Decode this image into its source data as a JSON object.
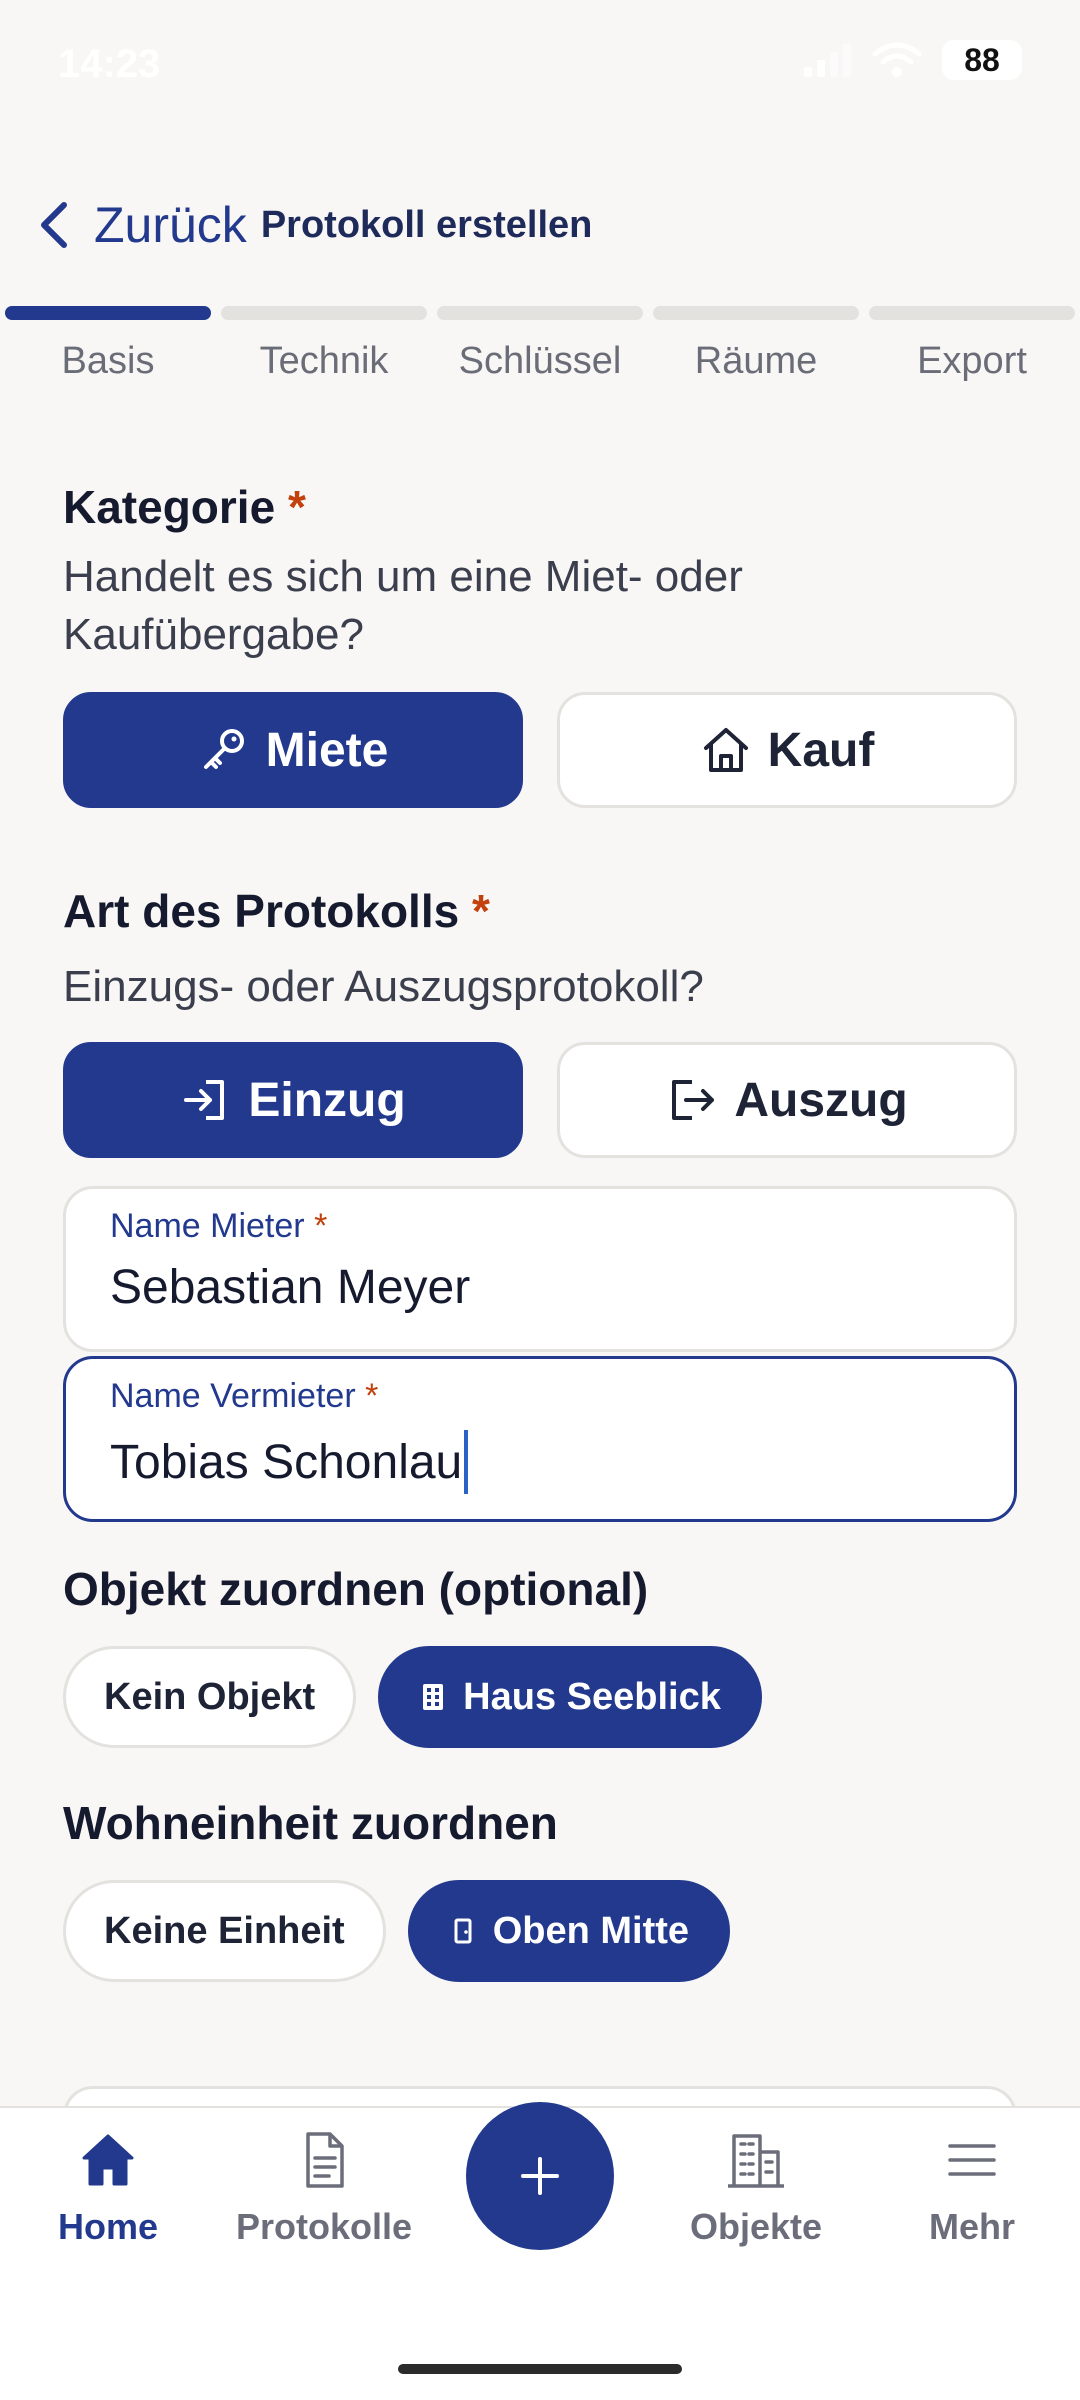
{
  "status_bar": {
    "time": "14:23",
    "battery": "88"
  },
  "header": {
    "back_label": "Zurück",
    "title": "Protokoll erstellen"
  },
  "steps": [
    {
      "label": "Basis",
      "active": true
    },
    {
      "label": "Technik",
      "active": false
    },
    {
      "label": "Schlüssel",
      "active": false
    },
    {
      "label": "Räume",
      "active": false
    },
    {
      "label": "Export",
      "active": false
    }
  ],
  "kategorie": {
    "title": "Kategorie",
    "required_mark": "*",
    "description": "Handelt es sich um eine Miet- oder Kaufübergabe?",
    "options": [
      {
        "label": "Miete",
        "icon": "key-icon",
        "selected": true
      },
      {
        "label": "Kauf",
        "icon": "house-icon",
        "selected": false
      }
    ]
  },
  "protokoll_art": {
    "title": "Art des Protokolls",
    "required_mark": "*",
    "description": "Einzugs- oder Auszugsprotokoll?",
    "options": [
      {
        "label": "Einzug",
        "icon": "sign-in-icon",
        "selected": true
      },
      {
        "label": "Auszug",
        "icon": "sign-out-icon",
        "selected": false
      }
    ]
  },
  "fields": {
    "mieter": {
      "label": "Name Mieter",
      "required_mark": "*",
      "value": "Sebastian Meyer"
    },
    "vermieter": {
      "label": "Name Vermieter",
      "required_mark": "*",
      "value": "Tobias Schonlau"
    }
  },
  "objekt": {
    "title": "Objekt zuordnen (optional)",
    "options": [
      {
        "label": "Kein Objekt",
        "selected": false
      },
      {
        "label": "Haus Seeblick",
        "icon": "building-icon",
        "selected": true
      }
    ]
  },
  "wohneinheit": {
    "title": "Wohneinheit zuordnen",
    "options": [
      {
        "label": "Keine Einheit",
        "selected": false
      },
      {
        "label": "Oben Mitte",
        "icon": "door-icon",
        "selected": true
      }
    ]
  },
  "tab_bar": {
    "items": [
      {
        "label": "Home",
        "icon": "home-icon",
        "active": true
      },
      {
        "label": "Protokolle",
        "icon": "document-icon",
        "active": false
      },
      {
        "label": "Objekte",
        "icon": "buildings-icon",
        "active": false
      },
      {
        "label": "Mehr",
        "icon": "menu-icon",
        "active": false
      }
    ],
    "fab_icon": "plus-icon"
  },
  "colors": {
    "primary": "#22398e",
    "required": "#c2410c",
    "background": "#f8f7f5"
  }
}
